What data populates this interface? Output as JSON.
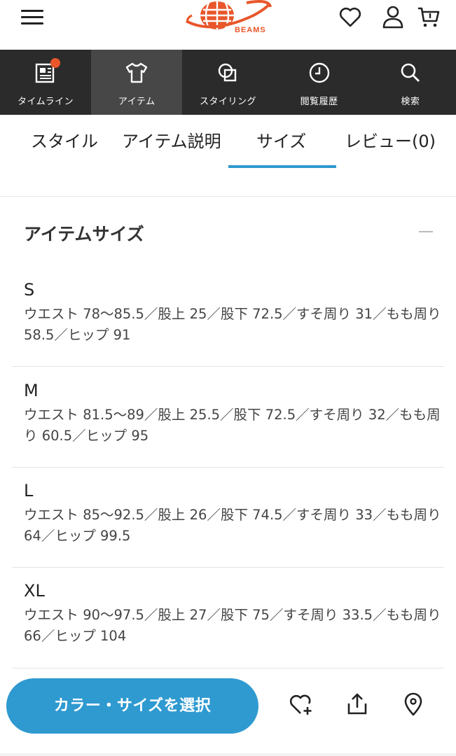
{
  "header": {
    "brand": "BEAMS",
    "icons": [
      "menu-icon",
      "heart-icon",
      "user-icon",
      "cart-icon"
    ]
  },
  "nav": {
    "items": [
      {
        "label": "タイムライン",
        "icon": "timeline-icon",
        "badge": true
      },
      {
        "label": "アイテム",
        "icon": "tshirt-icon",
        "active": true
      },
      {
        "label": "スタイリング",
        "icon": "styling-icon"
      },
      {
        "label": "閲覧履歴",
        "icon": "clock-icon"
      },
      {
        "label": "検索",
        "icon": "search-icon"
      }
    ]
  },
  "tabs": {
    "items": [
      {
        "label": "スタイル"
      },
      {
        "label": "アイテム説明"
      },
      {
        "label": "サイズ",
        "active": true
      },
      {
        "label": "レビュー(0)"
      }
    ]
  },
  "sizes_section": {
    "title": "アイテムサイズ",
    "items": [
      {
        "name": "S",
        "desc": "ウエスト 78〜85.5／股上 25／股下 72.5／すそ周り 31／もも周り 58.5／ヒップ 91"
      },
      {
        "name": "M",
        "desc": "ウエスト 81.5〜89／股上 25.5／股下 72.5／すそ周り 32／もも周り 60.5／ヒップ 95"
      },
      {
        "name": "L",
        "desc": "ウエスト 85〜92.5／股上 26／股下 74.5／すそ周り 33／もも周り 64／ヒップ 99.5"
      },
      {
        "name": "XL",
        "desc": "ウエスト 90〜97.5／股上 27／股下 75／すそ周り 33.5／もも周り 66／ヒップ 104"
      }
    ]
  },
  "bottom": {
    "select_button": "カラー・サイズを選択"
  },
  "colors": {
    "accent": "#2f9ad0",
    "brand": "#e8562a",
    "nav_bg": "#2b2b2b"
  }
}
